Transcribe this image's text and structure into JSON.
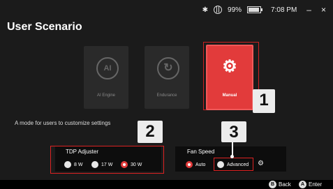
{
  "status": {
    "battery": "99%",
    "time": "7:08 PM",
    "minimize": "–",
    "close": "×",
    "bluetooth_glyph": "✱"
  },
  "page": {
    "title": "User Scenario"
  },
  "scenarios": [
    {
      "label": "AI Engine",
      "glyph": "AI",
      "selected": false
    },
    {
      "label": "Endurance",
      "glyph": "↻",
      "selected": false
    },
    {
      "label": "Manual",
      "glyph": "⚙",
      "selected": true
    }
  ],
  "description": "A mode for users to customize settings",
  "markers": {
    "m1": "1",
    "m2": "2",
    "m3": "3"
  },
  "tdp": {
    "title": "TDP Adjuster",
    "options": [
      "8 W",
      "17 W",
      "30 W"
    ],
    "selected": "30 W"
  },
  "fan": {
    "title": "Fan Speed",
    "options": [
      "Auto",
      "Advanced"
    ],
    "selected": "Auto"
  },
  "footer": {
    "back_key": "B",
    "back": "Back",
    "enter_key": "A",
    "enter": "Enter"
  },
  "colors": {
    "accent": "#e23b3b",
    "background": "#1b1b1b"
  }
}
